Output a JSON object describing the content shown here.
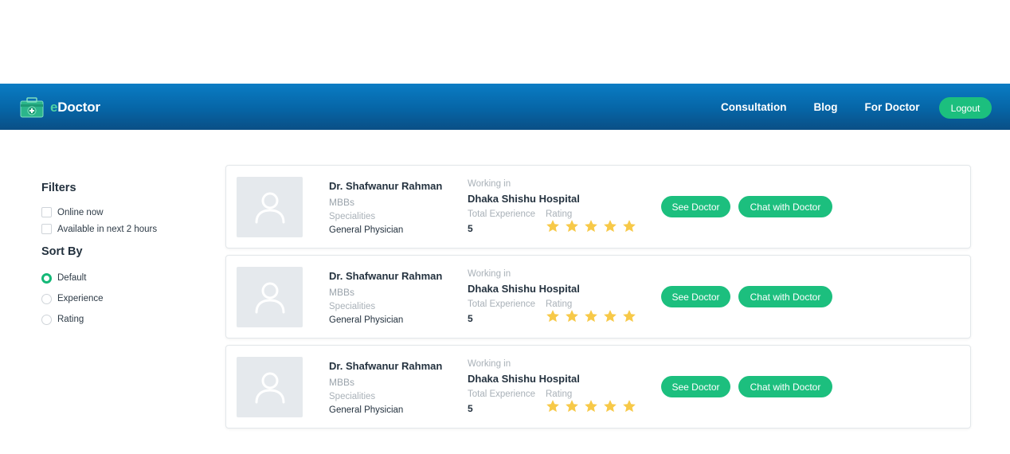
{
  "header": {
    "brand_prefix": "e",
    "brand_rest": "Doctor",
    "brand_icon": "medical-kit-icon",
    "nav": [
      "Consultation",
      "Blog",
      "For Doctor"
    ],
    "logout_label": "Logout"
  },
  "sidebar": {
    "filters_title": "Filters",
    "filters": [
      {
        "label": "Online now",
        "checked": false
      },
      {
        "label": "Available in next 2 hours",
        "checked": false
      }
    ],
    "sort_title": "Sort By",
    "sort_options": [
      {
        "label": "Default",
        "selected": true
      },
      {
        "label": "Experience",
        "selected": false
      },
      {
        "label": "Rating",
        "selected": false
      }
    ]
  },
  "doctors": [
    {
      "name": "Dr. Shafwanur Rahman",
      "degree": "MBBs",
      "speciality_label": "Specialities",
      "speciality": "General Physician",
      "working_label": "Working in",
      "hospital": "Dhaka Shishu Hospital",
      "experience_label": "Total Experience",
      "experience": "5",
      "rating_label": "Rating",
      "rating": 5,
      "see_label": "See Doctor",
      "chat_label": "Chat with Doctor"
    },
    {
      "name": "Dr. Shafwanur Rahman",
      "degree": "MBBs",
      "speciality_label": "Specialities",
      "speciality": "General Physician",
      "working_label": "Working in",
      "hospital": "Dhaka Shishu Hospital",
      "experience_label": "Total Experience",
      "experience": "5",
      "rating_label": "Rating",
      "rating": 5,
      "see_label": "See Doctor",
      "chat_label": "Chat with Doctor"
    },
    {
      "name": "Dr. Shafwanur Rahman",
      "degree": "MBBs",
      "speciality_label": "Specialities",
      "speciality": "General Physician",
      "working_label": "Working in",
      "hospital": "Dhaka Shishu Hospital",
      "experience_label": "Total Experience",
      "experience": "5",
      "rating_label": "Rating",
      "rating": 5,
      "see_label": "See Doctor",
      "chat_label": "Chat with Doctor"
    }
  ],
  "colors": {
    "navbar": "#0a6fb5",
    "accent_green": "#1cbf7e",
    "star_yellow": "#f7c948",
    "avatar_bg": "#e5e9ed"
  }
}
